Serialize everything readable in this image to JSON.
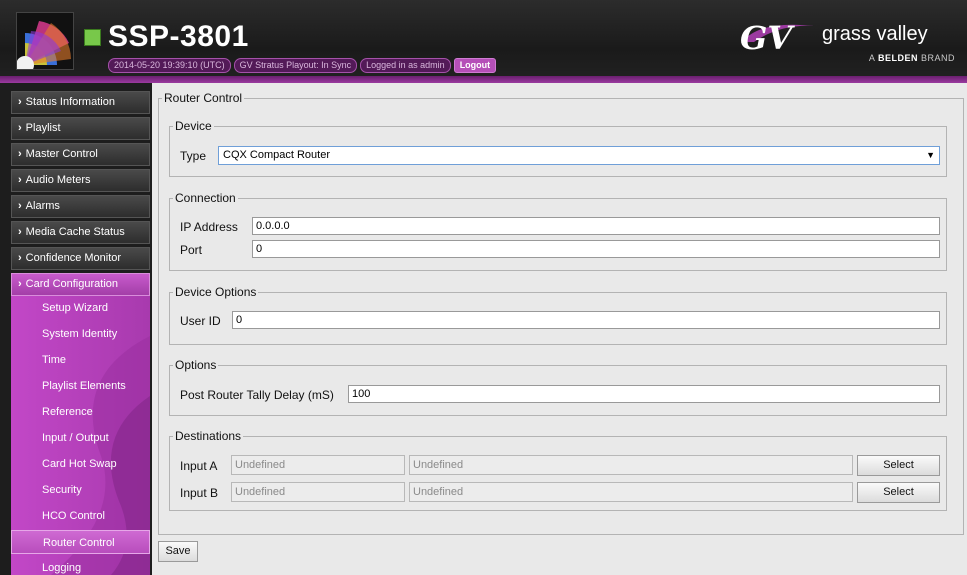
{
  "header": {
    "title": "SSP-3801",
    "status_pills": [
      "2014-05-20 19:39:10 (UTC)",
      "GV Stratus Playout: In Sync",
      "Logged in as admin"
    ],
    "logout_label": "Logout",
    "brand": {
      "mark": "GV",
      "name": "grass valley",
      "tagline_prefix": "A",
      "tagline_brand": "BELDEN",
      "tagline_suffix": "BRAND"
    },
    "status_color": "#78c84a",
    "accent_color": "#9b3aa0"
  },
  "sidebar": {
    "items": [
      {
        "label": "Status Information",
        "icon": "chevron-right-icon"
      },
      {
        "label": "Playlist",
        "icon": "chevron-right-icon"
      },
      {
        "label": "Master Control",
        "icon": "chevron-right-icon"
      },
      {
        "label": "Audio Meters",
        "icon": "chevron-right-icon"
      },
      {
        "label": "Alarms",
        "icon": "chevron-right-icon"
      },
      {
        "label": "Media Cache Status",
        "icon": "chevron-right-icon"
      },
      {
        "label": "Confidence Monitor",
        "icon": "chevron-right-icon"
      },
      {
        "label": "Card Configuration",
        "icon": "chevron-right-icon"
      }
    ],
    "submenu": [
      "Setup Wizard",
      "System Identity",
      "Time",
      "Playlist Elements",
      "Reference",
      "Input / Output",
      "Card Hot Swap",
      "Security",
      "HCO Control",
      "Router Control",
      "Logging"
    ],
    "selected_submenu": "Router Control"
  },
  "main": {
    "section_title": "Router Control",
    "device": {
      "legend": "Device",
      "type_label": "Type",
      "type_value": "CQX Compact Router"
    },
    "connection": {
      "legend": "Connection",
      "ip_label": "IP Address",
      "ip_value": "0.0.0.0",
      "port_label": "Port",
      "port_value": "0"
    },
    "device_options": {
      "legend": "Device Options",
      "user_id_label": "User ID",
      "user_id_value": "0"
    },
    "options": {
      "legend": "Options",
      "tally_label": "Post Router Tally Delay (mS)",
      "tally_value": "100"
    },
    "destinations": {
      "legend": "Destinations",
      "rows": [
        {
          "label": "Input A",
          "value1": "Undefined",
          "value2": "Undefined",
          "button": "Select"
        },
        {
          "label": "Input B",
          "value1": "Undefined",
          "value2": "Undefined",
          "button": "Select"
        }
      ]
    },
    "save_label": "Save"
  }
}
